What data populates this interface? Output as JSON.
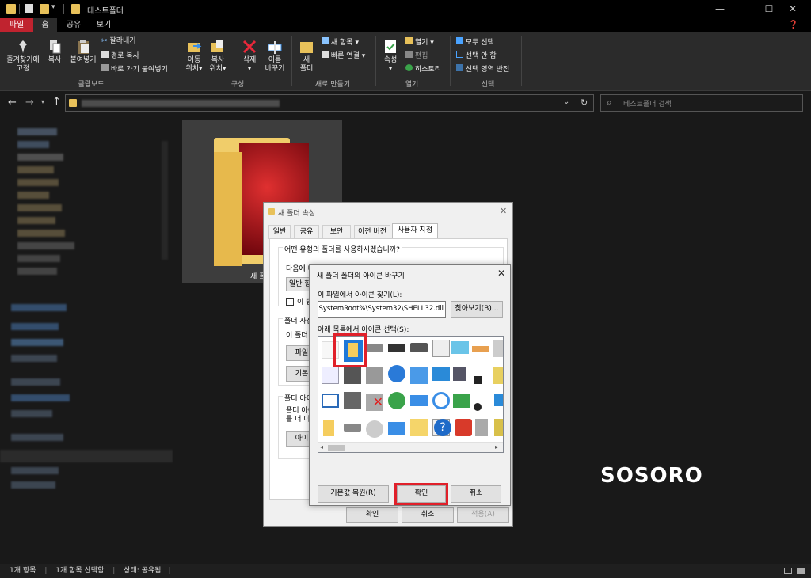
{
  "window": {
    "title": "테스트폴더",
    "min_glyph": "—",
    "max_glyph": "☐",
    "close_glyph": "✕"
  },
  "ribbon_tabs": [
    "파일",
    "홈",
    "공유",
    "보기"
  ],
  "ribbon": {
    "clipboard": {
      "pin": "즐겨찾기에\n고정",
      "copy": "복사",
      "paste": "붙여넣기",
      "cut": "잘라내기",
      "copy_path": "경로 복사",
      "paste_shortcut": "바로 가기 붙여넣기",
      "label": "클립보드"
    },
    "organize": {
      "move_to": "이동\n위치",
      "copy_to": "복사\n위치",
      "delete": "삭제",
      "rename": "이름\n바꾸기",
      "label": "구성"
    },
    "new": {
      "new_folder": "새\n폴더",
      "new_item": "새 항목",
      "easy_access": "빠른 연결",
      "label": "새로 만들기"
    },
    "open": {
      "properties": "속성",
      "open": "열기",
      "edit": "편집",
      "history": "히스토리",
      "label": "열기"
    },
    "select": {
      "select_all": "모두 선택",
      "select_none": "선택 안 함",
      "invert": "선택 영역 반전",
      "label": "선택"
    }
  },
  "search": {
    "placeholder": "테스트폴더 검색"
  },
  "content": {
    "folder_label": "새 폴"
  },
  "status": {
    "items": "1개 항목",
    "selected": "1개 항목 선택함",
    "state": "상태: 공유됨"
  },
  "props": {
    "title": "새 폴더 속성",
    "tabs": [
      "일반",
      "공유",
      "보안",
      "이전 버전",
      "사용자 지정"
    ],
    "q_type": "어떤 유형의 폴더를 사용하시겠습니까?",
    "optimize": "다음에 대해 이 폴더 최적화",
    "opt_value": "일반 항",
    "checkbox": "이 템",
    "pictures_group": "폴더 사진",
    "pictures_desc": "이 폴더",
    "file_btn": "파일",
    "default_btn": "기본",
    "icon_group": "폴더 아이",
    "icon_desc": "폴더 아이\n를 더 이",
    "change_icon_btn": "아이",
    "ok": "확인",
    "cancel": "취소",
    "apply": "적용(A)"
  },
  "icon_dialog": {
    "title": "새 폴더 폴더의 아이콘 바꾸기",
    "find_label": "이 파일에서 아이콘 찾기(L):",
    "path": "%SystemRoot%\\System32\\SHELL32.dll",
    "browse": "찾아보기(B)...",
    "select_label": "아래 목록에서 아이콘 선택(S):",
    "restore": "기본값 복원(R)",
    "ok": "확인",
    "cancel": "취소"
  },
  "watermark": "SOSORO",
  "colors": {
    "accent_red": "#e0202a",
    "file_tab": "#c0232f",
    "folder_yellow": "#e8c15a"
  }
}
